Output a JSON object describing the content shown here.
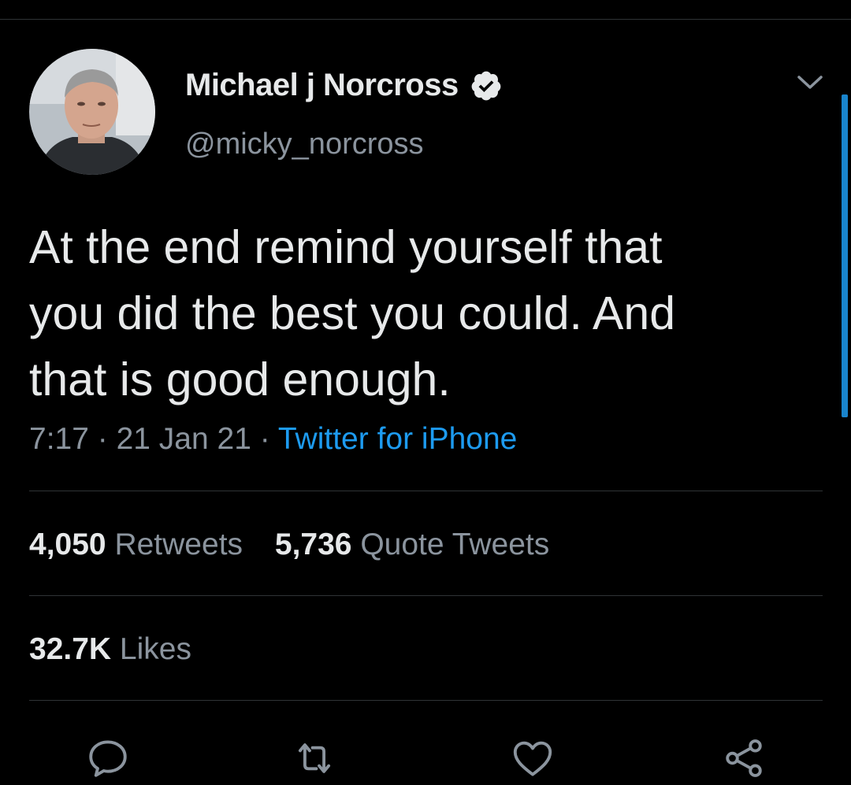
{
  "tweet": {
    "author": {
      "display_name": "Michael j Norcross",
      "handle": "@micky_norcross",
      "verified": true
    },
    "text": "At the end remind yourself that\nyou did the best you could. And\nthat is good enough.",
    "time": "7:17",
    "date": "21 Jan 21",
    "separator": "·",
    "source": "Twitter for iPhone"
  },
  "stats": {
    "retweets_count": "4,050",
    "retweets_label": "Retweets",
    "quotes_count": "5,736",
    "quotes_label": "Quote Tweets",
    "likes_count": "32.7K",
    "likes_label": "Likes"
  },
  "actions": {
    "reply_icon": "comment-icon",
    "retweet_icon": "retweet-icon",
    "like_icon": "heart-icon",
    "share_icon": "share-icon"
  },
  "colors": {
    "background": "#000000",
    "text_primary": "#e7e9ea",
    "text_secondary": "#8b949e",
    "accent": "#1d9bf0",
    "divider": "#2f3336"
  }
}
